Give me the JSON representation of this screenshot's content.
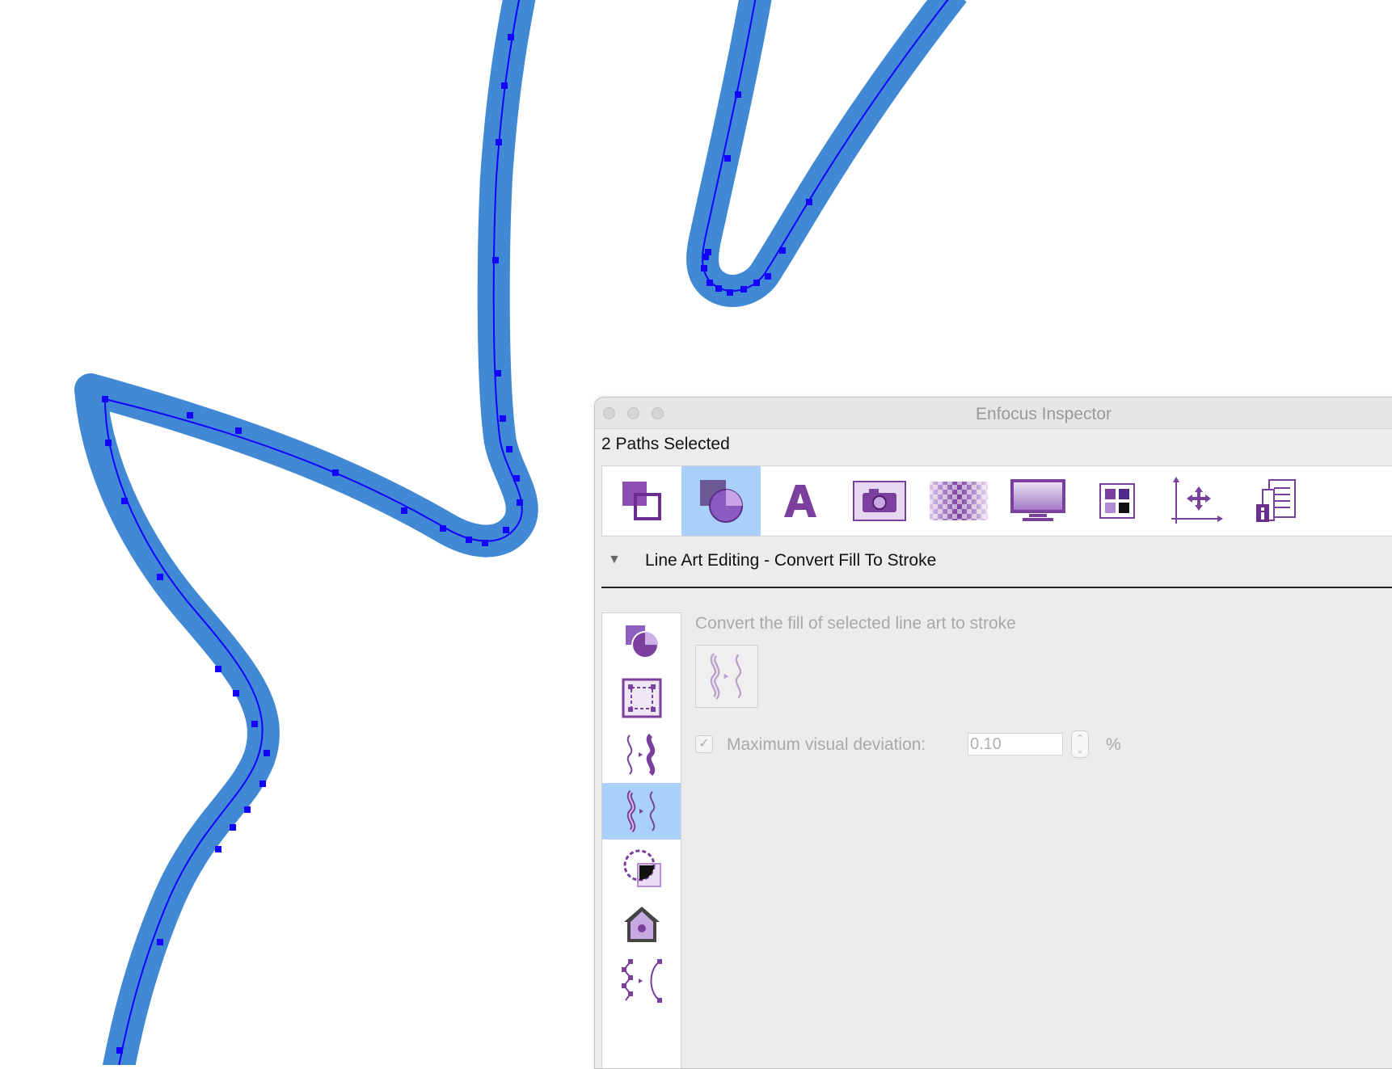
{
  "window": {
    "title": "Enfocus Inspector",
    "selection_status": "2 Paths Selected"
  },
  "toolbar": {
    "active": "line-art",
    "buttons": [
      {
        "name": "objects",
        "icon": "objects-icon"
      },
      {
        "name": "line-art",
        "icon": "line-art-icon"
      },
      {
        "name": "text",
        "icon": "text-icon",
        "glyph": "A"
      },
      {
        "name": "image",
        "icon": "camera-icon"
      },
      {
        "name": "transparency",
        "icon": "transparency-icon"
      },
      {
        "name": "display",
        "icon": "monitor-icon"
      },
      {
        "name": "color",
        "icon": "color-swatches-icon"
      },
      {
        "name": "position",
        "icon": "move-axes-icon"
      },
      {
        "name": "document-info",
        "icon": "document-info-icon"
      }
    ]
  },
  "section": {
    "title": "Line Art Editing - Convert Fill To Stroke",
    "expanded": true
  },
  "sidebar": {
    "active": "convert-fill-to-stroke",
    "items": [
      {
        "name": "shape",
        "icon": "shape-icon"
      },
      {
        "name": "bounds",
        "icon": "bounding-box-icon"
      },
      {
        "name": "convert-stroke-to-fill",
        "icon": "stroke-to-fill-icon"
      },
      {
        "name": "convert-fill-to-stroke",
        "icon": "fill-to-stroke-icon"
      },
      {
        "name": "clipping",
        "icon": "clip-shape-icon"
      },
      {
        "name": "trap",
        "icon": "house-icon"
      },
      {
        "name": "simplify-path",
        "icon": "simplify-path-icon"
      }
    ]
  },
  "content": {
    "description": "Convert the fill of selected line art to stroke",
    "convert_button_icon": "fill-to-stroke-icon",
    "deviation": {
      "checked": true,
      "label": "Maximum visual deviation:",
      "value": "0.10",
      "unit": "%"
    }
  },
  "colors": {
    "stroke_outer": "#4189d4",
    "path_inner": "#1400ff",
    "selection_highlight": "#a9d0fb",
    "icon_purple": "#7b3f9e"
  }
}
